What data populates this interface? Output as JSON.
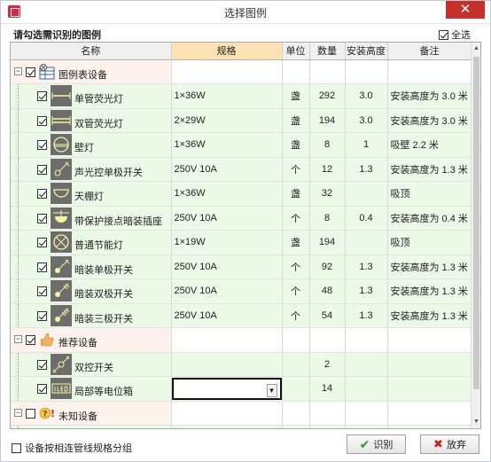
{
  "window": {
    "title": "选择图例",
    "close_glyph": "✕"
  },
  "prompt": "请勾选需识别的图例",
  "select_all": {
    "label": "全选",
    "checked": true
  },
  "columns": {
    "name": "名称",
    "spec": "规格",
    "unit": "单位",
    "qty": "数量",
    "height": "安装高度",
    "note": "备注"
  },
  "groups": [
    {
      "label": "图例表设备",
      "expander": "−",
      "checked": true
    },
    {
      "label": "推荐设备",
      "expander": "−",
      "checked": true
    },
    {
      "label": "未知设备",
      "expander": "−",
      "checked": false
    }
  ],
  "items": [
    {
      "name": "单管荧光灯",
      "spec": "1×36W",
      "unit": "盏",
      "qty": "292",
      "height": "3.0",
      "note": "安装高度为 3.0 米",
      "checked": true
    },
    {
      "name": "双管荧光灯",
      "spec": "2×29W",
      "unit": "盏",
      "qty": "194",
      "height": "3.0",
      "note": "安装高度为 3.0 米",
      "checked": true
    },
    {
      "name": "壁灯",
      "spec": "1×36W",
      "unit": "盏",
      "qty": "8",
      "height": "1",
      "note": "吸壁 2.2 米",
      "checked": true
    },
    {
      "name": "声光控单极开关",
      "spec": "250V 10A",
      "unit": "个",
      "qty": "12",
      "height": "1.3",
      "note": "安装高度为 1.3 米",
      "checked": true
    },
    {
      "name": "天棚灯",
      "spec": "1×36W",
      "unit": "盏",
      "qty": "32",
      "height": "",
      "note": "吸顶",
      "checked": true
    },
    {
      "name": "带保护接点暗装插座",
      "spec": "250V 10A",
      "unit": "个",
      "qty": "8",
      "height": "0.4",
      "note": "安装高度为 0.4 米",
      "checked": true
    },
    {
      "name": "普通节能灯",
      "spec": "1×19W",
      "unit": "盏",
      "qty": "194",
      "height": "",
      "note": "吸顶",
      "checked": true
    },
    {
      "name": "暗装单极开关",
      "spec": "250V 10A",
      "unit": "个",
      "qty": "92",
      "height": "1.3",
      "note": "安装高度为 1.3 米",
      "checked": true
    },
    {
      "name": "暗装双极开关",
      "spec": "250V 10A",
      "unit": "个",
      "qty": "48",
      "height": "1.3",
      "note": "安装高度为 1.3 米",
      "checked": true
    },
    {
      "name": "暗装三极开关",
      "spec": "250V 10A",
      "unit": "个",
      "qty": "54",
      "height": "1.3",
      "note": "安装高度为 1.3 米",
      "checked": true
    },
    {
      "name": "双控开关",
      "spec": "",
      "unit": "",
      "qty": "2",
      "height": "",
      "note": "",
      "checked": true
    },
    {
      "name": "局部等电位箱",
      "spec": "",
      "unit": "",
      "qty": "14",
      "height": "",
      "note": "",
      "checked": true
    }
  ],
  "dropdown_glyph": "▼",
  "scroll": {
    "up": "▲",
    "down": "▼"
  },
  "bottom": {
    "group_option": "设备按相连管线规格分组",
    "ok_label": "识别",
    "cancel_label": "放弃"
  },
  "icons": {
    "ok": "check-icon",
    "cancel": "x-icon",
    "group0": "legend-table-icon",
    "group1": "thumbs-up-icon",
    "group2": "unknown-icon"
  }
}
